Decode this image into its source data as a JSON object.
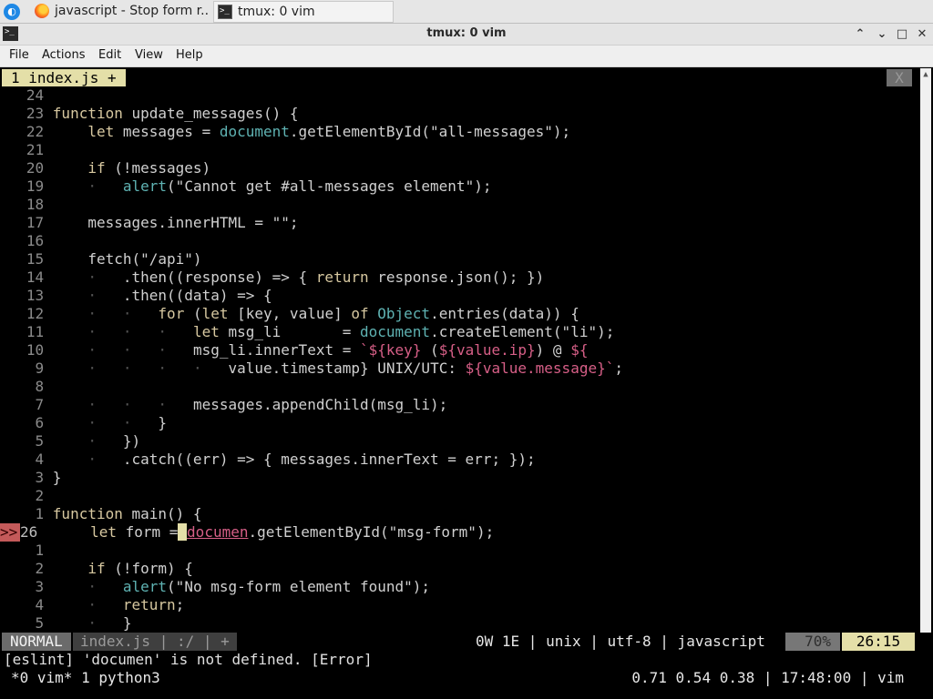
{
  "taskbar": {
    "tasks": [
      {
        "label": "javascript - Stop form r...",
        "icon": "firefox-icon"
      },
      {
        "label": "tmux: 0 vim",
        "icon": "terminal-icon"
      }
    ]
  },
  "window": {
    "title": "tmux: 0 vim",
    "controls": {
      "collapse": "⌃",
      "maximize": "□",
      "close": "✕"
    }
  },
  "menu": {
    "items": [
      "File",
      "Actions",
      "Edit",
      "View",
      "Help"
    ]
  },
  "vim": {
    "tab": {
      "label": "1 index.js +",
      "close": "X"
    },
    "lines": [
      {
        "num": "24",
        "code": ""
      },
      {
        "num": "23",
        "code": "function update_messages() {"
      },
      {
        "num": "22",
        "code": "    let messages = document.getElementById(\"all-messages\");"
      },
      {
        "num": "21",
        "code": ""
      },
      {
        "num": "20",
        "code": "    if (!messages)"
      },
      {
        "num": "19",
        "code": "    ·   alert(\"Cannot get #all-messages element\");"
      },
      {
        "num": "18",
        "code": ""
      },
      {
        "num": "17",
        "code": "    messages.innerHTML = \"\";"
      },
      {
        "num": "16",
        "code": ""
      },
      {
        "num": "15",
        "code": "    fetch(\"/api\")"
      },
      {
        "num": "14",
        "code": "    ·   .then((response) => { return response.json(); })"
      },
      {
        "num": "13",
        "code": "    ·   .then((data) => {"
      },
      {
        "num": "12",
        "code": "    ·   ·   for (let [key, value] of Object.entries(data)) {"
      },
      {
        "num": "11",
        "code": "    ·   ·   ·   let msg_li       = document.createElement(\"li\");"
      },
      {
        "num": "10",
        "code": "    ·   ·   ·   msg_li.innerText = `${key} (${value.ip}) @ ${"
      },
      {
        "num": "9",
        "code": "    ·   ·   ·   ·   value.timestamp} UNIX/UTC: ${value.message}`;"
      },
      {
        "num": "8",
        "code": ""
      },
      {
        "num": "7",
        "code": "    ·   ·   ·   messages.appendChild(msg_li);"
      },
      {
        "num": "6",
        "code": "    ·   ·   }"
      },
      {
        "num": "5",
        "code": "    ·   })"
      },
      {
        "num": "4",
        "code": "    ·   .catch((err) => { messages.innerText = err; });"
      },
      {
        "num": "3",
        "code": "}"
      },
      {
        "num": "2",
        "code": ""
      },
      {
        "num": "1",
        "code": "function main() {"
      },
      {
        "num": "26",
        "code_before": "    let form =",
        "cursor": " ",
        "err_word": "documen",
        "code_after": ".getElementById(\"msg-form\");",
        "sign": ">>"
      },
      {
        "num": "1",
        "code": ""
      },
      {
        "num": "2",
        "code": "    if (!form) {"
      },
      {
        "num": "3",
        "code": "    ·   alert(\"No msg-form element found\");"
      },
      {
        "num": "4",
        "code": "    ·   return;"
      },
      {
        "num": "5",
        "code": "    ·   }"
      }
    ],
    "status": {
      "mode": "NORMAL",
      "file": "index.js | :/ | +",
      "info": "0W 1E | unix | utf-8 | javascript",
      "percent": "70%",
      "position": "26:15"
    },
    "message": "[eslint] 'documen' is not defined. [Error]"
  },
  "tmux": {
    "left": "*0 vim* 1 python3",
    "right": "0.71 0.54 0.38 | 17:48:00 | vim"
  },
  "colors": {
    "keyword": "#d7c8a0",
    "object": "#5fb3b3",
    "template": "#d75f87",
    "status_accent": "#e4dfa8"
  }
}
